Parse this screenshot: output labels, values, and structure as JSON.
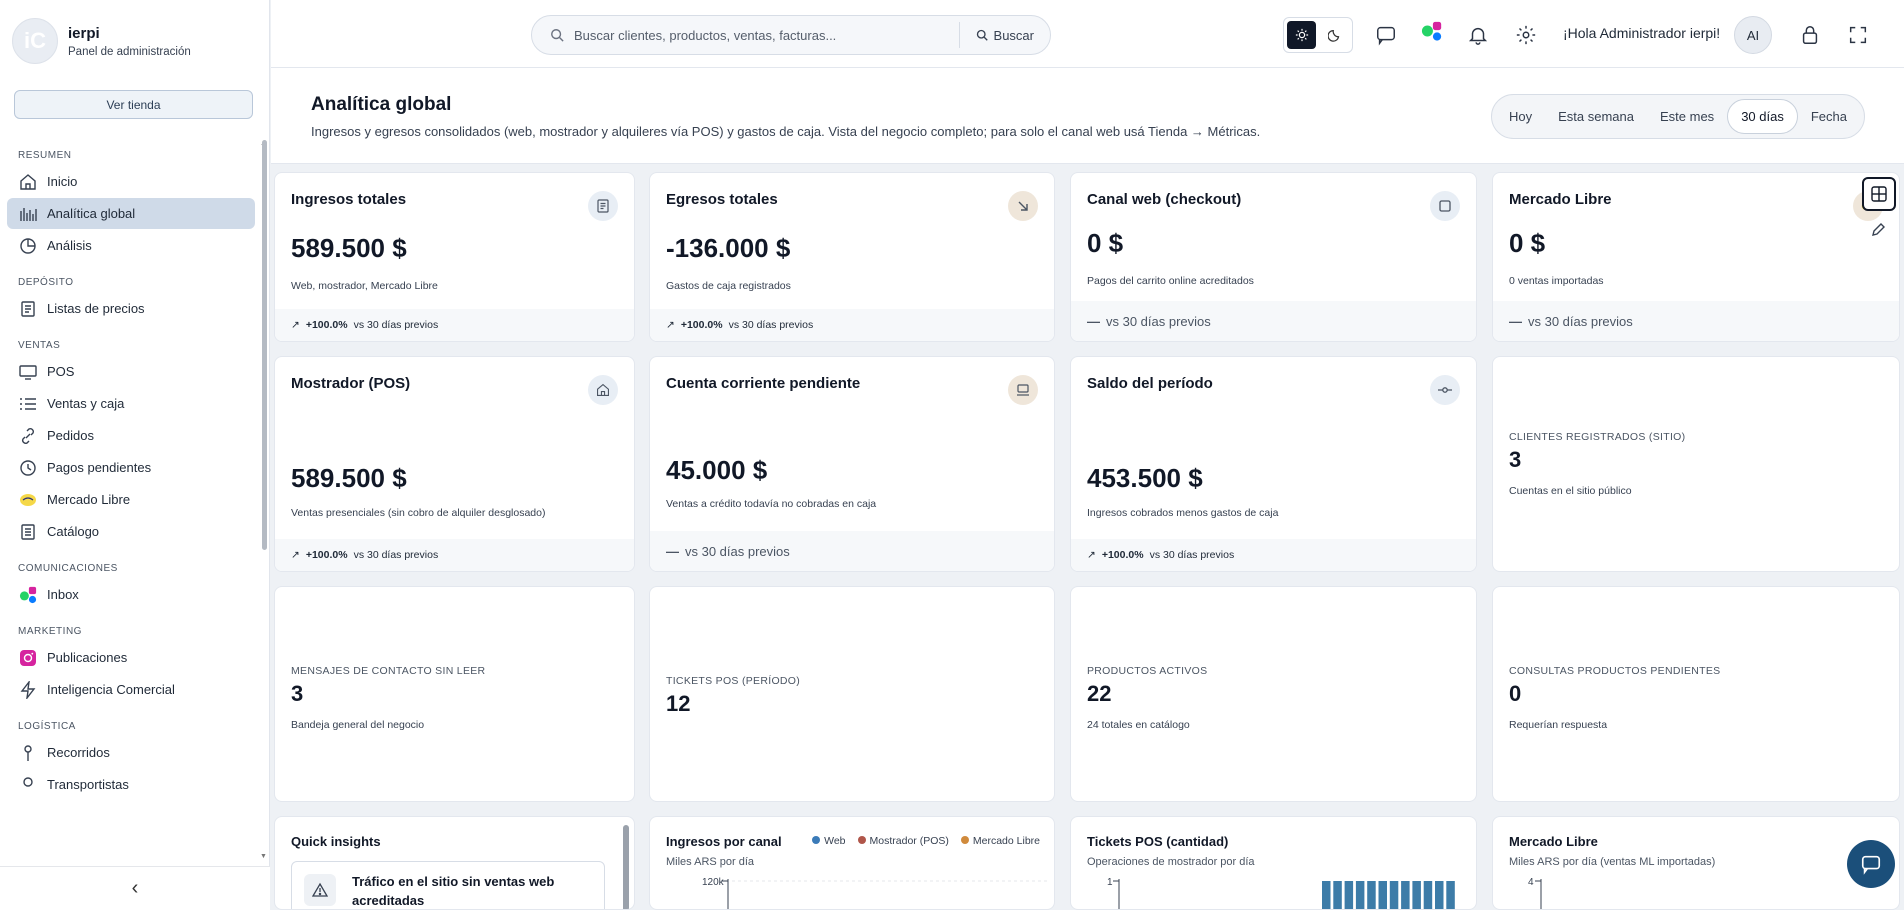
{
  "brand": {
    "name": "ierpi",
    "subtitle": "Panel de administración",
    "logo_text": "iC"
  },
  "sidebar": {
    "store_button": "Ver tienda",
    "sections": [
      {
        "title": "RESUMEN",
        "items": [
          {
            "label": "Inicio",
            "icon": "home-icon"
          },
          {
            "label": "Analítica global",
            "icon": "bars-icon",
            "active": true
          },
          {
            "label": "Análisis",
            "icon": "pie-icon"
          }
        ]
      },
      {
        "title": "DEPÓSITO",
        "items": [
          {
            "label": "Listas de precios",
            "icon": "list-doc-icon"
          }
        ]
      },
      {
        "title": "VENTAS",
        "items": [
          {
            "label": "POS",
            "icon": "monitor-icon"
          },
          {
            "label": "Ventas y caja",
            "icon": "lines-icon"
          },
          {
            "label": "Pedidos",
            "icon": "link-icon"
          },
          {
            "label": "Pagos pendientes",
            "icon": "clock-icon"
          },
          {
            "label": "Mercado Libre",
            "icon": "ml-icon"
          },
          {
            "label": "Catálogo",
            "icon": "catalog-icon"
          }
        ]
      },
      {
        "title": "COMUNICACIONES",
        "items": [
          {
            "label": "Inbox",
            "icon": "inbox-apps-icon"
          }
        ]
      },
      {
        "title": "MARKETING",
        "items": [
          {
            "label": "Publicaciones",
            "icon": "instagram-icon"
          },
          {
            "label": "Inteligencia Comercial",
            "icon": "bolt-icon"
          }
        ]
      },
      {
        "title": "LOGÍSTICA",
        "items": [
          {
            "label": "Recorridos",
            "icon": "pin-icon"
          },
          {
            "label": "Transportistas",
            "icon": "truck-icon"
          }
        ]
      }
    ],
    "collapse_glyph": "‹"
  },
  "header": {
    "search_placeholder": "Buscar clientes, productos, ventas, facturas...",
    "search_button": "Buscar",
    "greeting": "¡Hola Administrador ierpi!",
    "avatar": "AI"
  },
  "page": {
    "title": "Analítica global",
    "subtitle": "Ingresos y egresos consolidados (web, mostrador y alquileres vía POS) y gastos de caja. Vista del negocio completo; para solo el canal web usá Tienda → Métricas.",
    "ranges": [
      "Hoy",
      "Esta semana",
      "Este mes",
      "30 días",
      "Fecha"
    ],
    "active_range": "30 días"
  },
  "kpis": [
    {
      "title": "Ingresos totales",
      "value": "589.500 $",
      "desc": "Web, mostrador, Mercado Libre",
      "trend": "+100.0%",
      "compare": "vs 30 días previos",
      "icon": "receipt-icon",
      "tone": "blue"
    },
    {
      "title": "Egresos totales",
      "value": "-136.000 $",
      "desc": "Gastos de caja registrados",
      "trend": "+100.0%",
      "compare": "vs 30 días previos",
      "icon": "arrow-down-right-icon",
      "tone": "tan"
    },
    {
      "title": "Canal web (checkout)",
      "value": "0 $",
      "desc": "Pagos del carrito online acreditados",
      "trend": "—",
      "compare": "vs 30 días previos",
      "icon": "square-icon",
      "tone": "blue"
    },
    {
      "title": "Mercado Libre",
      "value": "0 $",
      "desc": "0 ventas importadas",
      "trend": "—",
      "compare": "vs 30 días previos",
      "icon": "ml-icon",
      "tone": "tan"
    },
    {
      "title": "Mostrador (POS)",
      "value": "589.500 $",
      "desc": "Ventas presenciales (sin cobro de alquiler desglosado)",
      "trend": "+100.0%",
      "compare": "vs 30 días previos",
      "icon": "home-icon",
      "tone": "blue"
    },
    {
      "title": "Cuenta corriente pendiente",
      "value": "45.000 $",
      "desc": "Ventas a crédito todavía no cobradas en caja",
      "trend": "—",
      "compare": "vs 30 días previos",
      "icon": "laptop-icon",
      "tone": "tan"
    },
    {
      "title": "Saldo del período",
      "value": "453.500 $",
      "desc": "Ingresos cobrados menos gastos de caja",
      "trend": "+100.0%",
      "compare": "vs 30 días previos",
      "icon": "commit-icon",
      "tone": "blue"
    }
  ],
  "stats": [
    {
      "label": "CLIENTES REGISTRADOS (SITIO)",
      "value": "3",
      "desc": "Cuentas en el sitio público"
    },
    {
      "label": "MENSAJES DE CONTACTO SIN LEER",
      "value": "3",
      "desc": "Bandeja general del negocio"
    },
    {
      "label": "TICKETS POS (PERÍODO)",
      "value": "12",
      "desc": ""
    },
    {
      "label": "PRODUCTOS ACTIVOS",
      "value": "22",
      "desc": "24 totales en catálogo"
    },
    {
      "label": "CONSULTAS PRODUCTOS PENDIENTES",
      "value": "0",
      "desc": "Requerían respuesta"
    }
  ],
  "insights": {
    "title": "Quick insights",
    "item": "Tráfico en el sitio sin ventas web acreditadas"
  },
  "colors": {
    "web": "#3b7bb8",
    "mostrador": "#b0564a",
    "mercado_libre": "#d08a3c",
    "pos_bar": "#3d7ca8"
  },
  "chart_data": [
    {
      "type": "line",
      "title": "Ingresos por canal",
      "subtitle": "Miles ARS por día",
      "series": [
        {
          "name": "Web"
        },
        {
          "name": "Mostrador (POS)"
        },
        {
          "name": "Mercado Libre"
        }
      ],
      "y_ticks": [
        "120k"
      ]
    },
    {
      "type": "bar",
      "title": "Tickets POS (cantidad)",
      "subtitle": "Operaciones de mostrador por día",
      "y_ticks": [
        "1"
      ],
      "values": [
        1,
        1,
        1,
        1,
        1,
        1,
        1,
        1,
        1,
        1,
        1,
        1
      ]
    },
    {
      "type": "line",
      "title": "Mercado Libre",
      "subtitle": "Miles ARS por día (ventas ML importadas)",
      "y_ticks": [
        "4"
      ]
    }
  ]
}
